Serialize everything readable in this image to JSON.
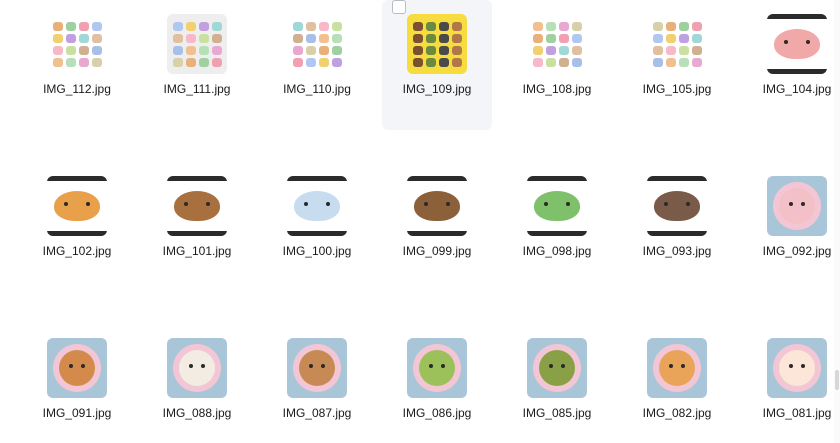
{
  "files": [
    {
      "name": "IMG_112.jpg",
      "kind": "grid",
      "bg": "#ffffff"
    },
    {
      "name": "IMG_111.jpg",
      "kind": "grid",
      "bg": "#eeeeee"
    },
    {
      "name": "IMG_110.jpg",
      "kind": "grid",
      "bg": "#ffffff"
    },
    {
      "name": "IMG_109.jpg",
      "kind": "grid",
      "bg": "#f6dc3e",
      "selected": true
    },
    {
      "name": "IMG_108.jpg",
      "kind": "grid",
      "bg": "#ffffff"
    },
    {
      "name": "IMG_105.jpg",
      "kind": "grid",
      "bg": "#ffffff"
    },
    {
      "name": "IMG_104.jpg",
      "kind": "letterbox",
      "subject": "pig",
      "color": "#f0a8a8"
    },
    {
      "name": "IMG_102.jpg",
      "kind": "letterbox",
      "subject": "rooster",
      "color": "#e8a04a"
    },
    {
      "name": "IMG_101.jpg",
      "kind": "letterbox",
      "subject": "monkey",
      "color": "#a8703e"
    },
    {
      "name": "IMG_100.jpg",
      "kind": "letterbox",
      "subject": "sheep",
      "color": "#c7dcef"
    },
    {
      "name": "IMG_099.jpg",
      "kind": "letterbox",
      "subject": "horse",
      "color": "#8c6038"
    },
    {
      "name": "IMG_098.jpg",
      "kind": "letterbox",
      "subject": "snake",
      "color": "#7fc06a"
    },
    {
      "name": "IMG_093.jpg",
      "kind": "letterbox",
      "subject": "rat",
      "color": "#7a5a48"
    },
    {
      "name": "IMG_092.jpg",
      "kind": "avatar",
      "subject": "pig",
      "color": "#f4c0c8"
    },
    {
      "name": "IMG_091.jpg",
      "kind": "avatar",
      "subject": "dog",
      "color": "#d48a4a"
    },
    {
      "name": "IMG_088.jpg",
      "kind": "avatar",
      "subject": "goat",
      "color": "#f3ece2"
    },
    {
      "name": "IMG_087.jpg",
      "kind": "avatar",
      "subject": "monkey",
      "color": "#c88a55"
    },
    {
      "name": "IMG_086.jpg",
      "kind": "avatar",
      "subject": "snake",
      "color": "#9cc15a"
    },
    {
      "name": "IMG_085.jpg",
      "kind": "avatar",
      "subject": "dragon",
      "color": "#8aa046"
    },
    {
      "name": "IMG_082.jpg",
      "kind": "avatar",
      "subject": "tiger",
      "color": "#e9a45a"
    },
    {
      "name": "IMG_081.jpg",
      "kind": "avatar",
      "subject": "pig",
      "color": "#fbe6d8"
    }
  ],
  "colors": {
    "avatar_bg": "#a9c6d9",
    "avatar_ring": "#f2c6d4",
    "selected_bg": "#f3f5f9"
  }
}
